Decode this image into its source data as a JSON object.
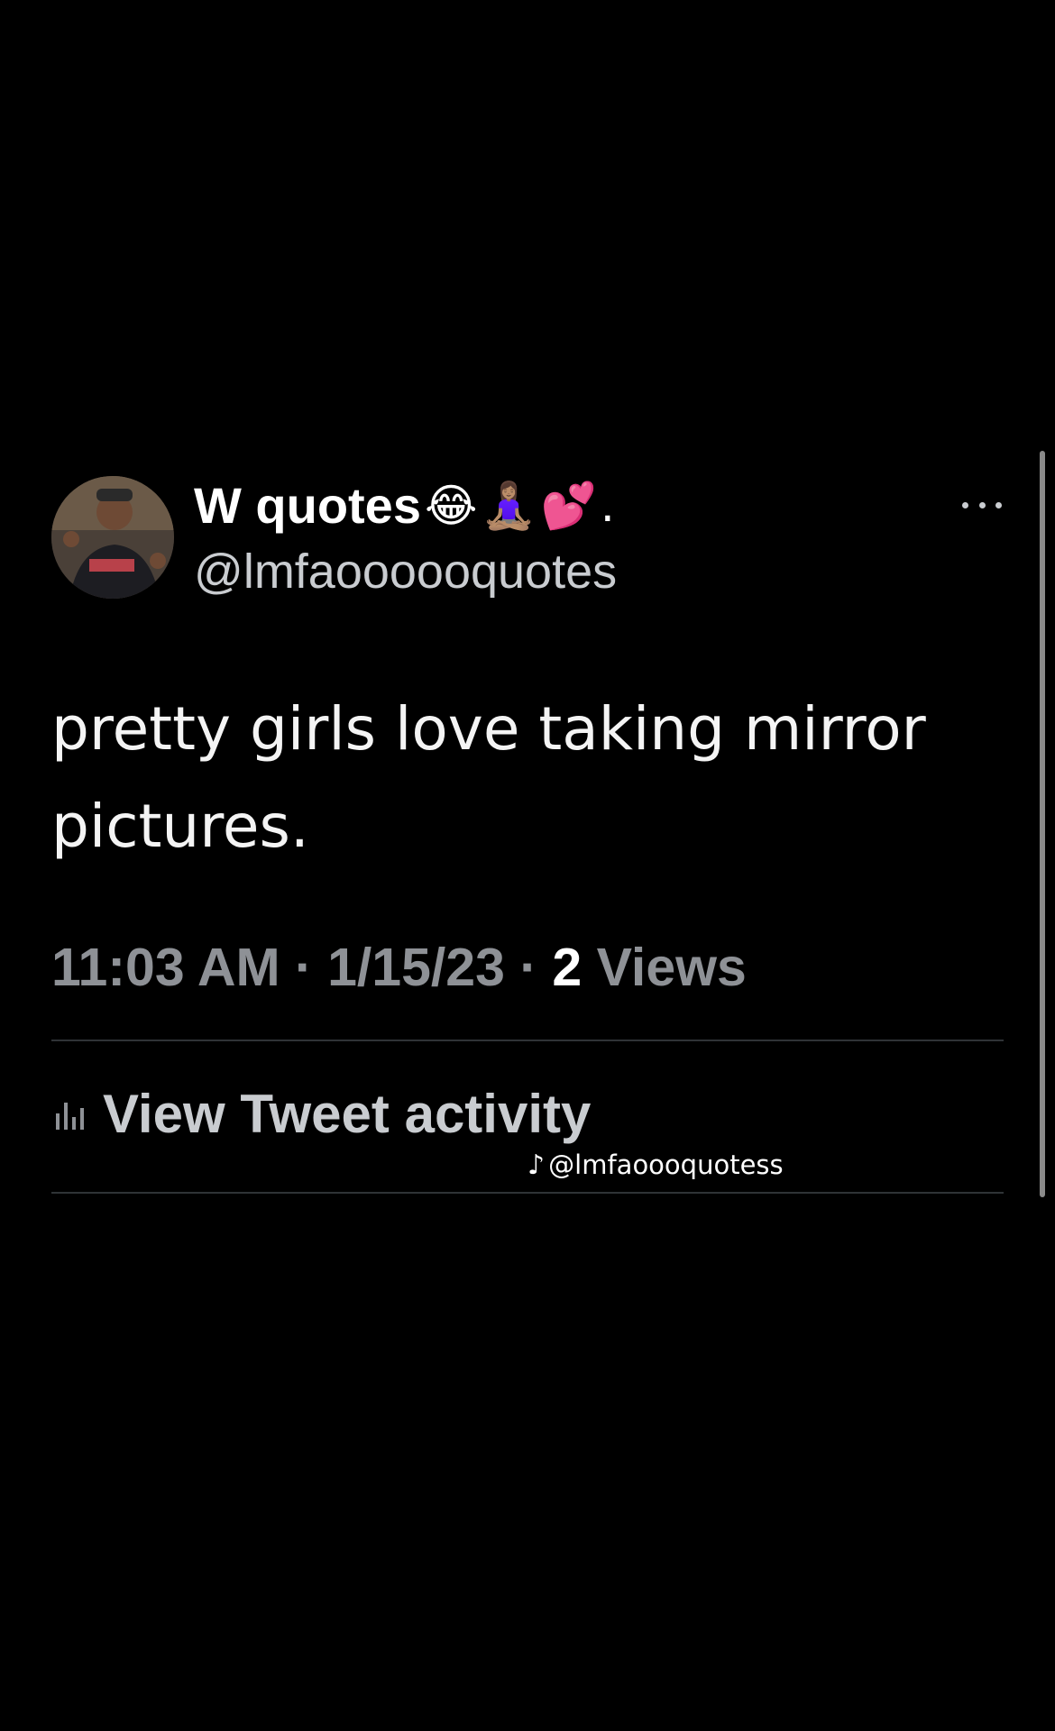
{
  "tweet": {
    "display_name": "W quotes",
    "display_name_emoji": "😂🧘🏽‍♀️💕.",
    "handle": "@lmfaoooooquotes",
    "text": "pretty girls love taking mirror pictures.",
    "time": "11:03 AM",
    "separator": "·",
    "date": "1/15/23",
    "views_count": "2",
    "views_label": "Views",
    "activity_label": "View Tweet activity"
  },
  "watermark": {
    "glyph": "♪",
    "handle": "@lmfaoooquotess"
  },
  "colors": {
    "background": "#000000",
    "primary_text": "#ffffff",
    "secondary_text": "#8e9196",
    "divider": "#2f3336"
  },
  "icons": {
    "more": "more-horizontal-icon",
    "activity": "bar-chart-icon",
    "watermark": "tiktok-logo-icon"
  }
}
